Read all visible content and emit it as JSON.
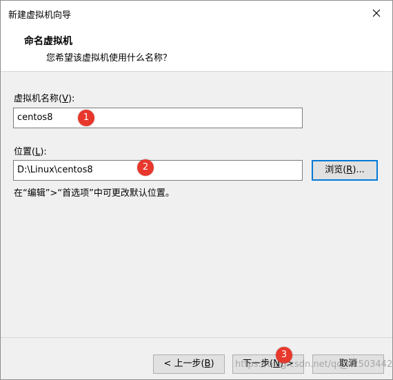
{
  "window": {
    "title": "新建虚拟机向导"
  },
  "header": {
    "title": "命名虚拟机",
    "subtitle": "您希望该虚拟机使用什么名称？"
  },
  "name_field": {
    "label_prefix": "虚拟机名称(",
    "label_key": "V",
    "label_suffix": "):",
    "value": "centos8"
  },
  "location_field": {
    "label_prefix": "位置(",
    "label_key": "L",
    "label_suffix": "):",
    "value": "D:\\Linux\\centos8"
  },
  "browse_button": {
    "prefix": "浏览(",
    "key": "R",
    "suffix": ")..."
  },
  "hint": "在“编辑”>“首选项”中可更改默认位置。",
  "footer": {
    "back": {
      "prefix": "< 上一步(",
      "key": "B",
      "suffix": ")"
    },
    "next": {
      "prefix": "下一步(",
      "key": "N",
      "suffix": ") >"
    },
    "cancel": "取消"
  },
  "annotations": [
    "1",
    "2",
    "3"
  ],
  "watermark": "https://blog.csdn.net/qq_42503442",
  "colors": {
    "badge": "#e8372c",
    "focus": "#0078d7"
  }
}
